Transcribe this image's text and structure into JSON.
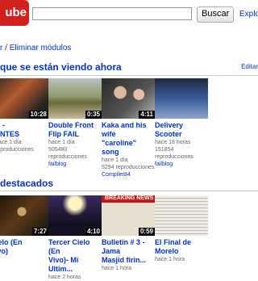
{
  "header": {
    "logo_text": "ube",
    "search_value": "",
    "search_button": "Buscar",
    "explore_link": "Explo"
  },
  "modules_bar": {
    "left": "r",
    "sep": "/",
    "remove": "Eliminar módulos"
  },
  "section1": {
    "title": "que se están viendo ahora",
    "edit": "Editar",
    "videos": [
      {
        "title_lines": [
          "N -",
          "ENTES"
        ],
        "duration": "10:28",
        "meta": [
          "hace 1 día",
          "reproducciones"
        ],
        "views": "",
        "user": "",
        "thumb": "t0"
      },
      {
        "title_lines": [
          "Double Front Flip FAIL"
        ],
        "duration": "0:35",
        "meta": [
          "hace 1 día",
          "505480",
          "reproducciones"
        ],
        "user": "failblog",
        "thumb": "t1"
      },
      {
        "title_lines": [
          "Kaka and his wife",
          "\"caroline\" song"
        ],
        "duration": "4:11",
        "meta": [
          "hace 1 día",
          "5294 reproducciones"
        ],
        "user": "Compiler84",
        "thumb": "t2"
      },
      {
        "title_lines": [
          "Delivery Scooter"
        ],
        "duration": "",
        "meta": [
          "hace 18 horas",
          "151854",
          "reproducciones"
        ],
        "user": "failblog",
        "thumb": "t3"
      }
    ]
  },
  "section2": {
    "title": "destacados",
    "videos": [
      {
        "title_lines": [
          "relo (En",
          "ivo)"
        ],
        "duration": "7:27",
        "meta": [],
        "thumb": "b0"
      },
      {
        "title_lines": [
          "Tercer Cielo (En",
          "Vivo)- Mi Ultim..."
        ],
        "duration": "4:10",
        "meta": [
          "hace 2 horas"
        ],
        "thumb": "b1"
      },
      {
        "title_lines": [
          "Bulletin # 3 - Jama",
          "Masjid firin..."
        ],
        "duration": "0:59",
        "meta": [
          "hace 1 hora"
        ],
        "thumb": "b2",
        "badge": "BREAKING NEWS"
      },
      {
        "title_lines": [
          "El Final de Morelo"
        ],
        "duration": "",
        "meta": [
          "hace 1 hora"
        ],
        "thumb": "b3"
      }
    ]
  }
}
